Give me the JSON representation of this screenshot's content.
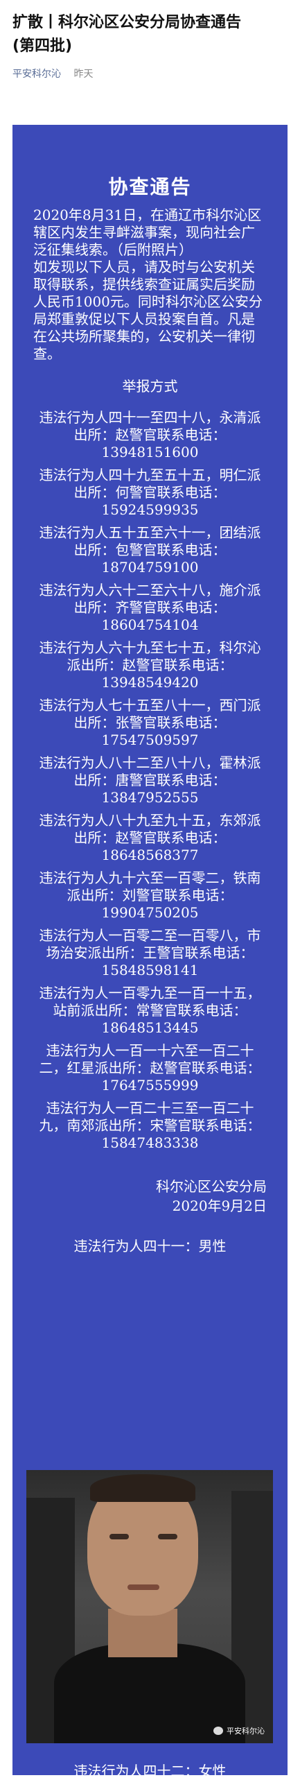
{
  "article": {
    "title_line1": "扩散丨科尔沁区公安分局协查通告",
    "title_line2": "(第四批)",
    "source": "平安科尔沁",
    "time": "昨天"
  },
  "notice": {
    "heading": "协查通告",
    "para1": "2020年8月31日，在通辽市科尔沁区辖区内发生寻衅滋事案，现向社会广泛征集线索。（后附照片）",
    "para2": "如发现以下人员，请及时与公安机关取得联系，提供线索查证属实后奖励人民币1000元。同时科尔沁区公安分局郑重敦促以下人员投案自首。凡是在公共场所聚集的，公安机关一律彻查。",
    "report_head": "举报方式",
    "entries": [
      "违法行为人四十一至四十八，永清派出所：赵警官联系电话：13948151600",
      "违法行为人四十九至五十五，明仁派出所：何警官联系电话：15924599935",
      "违法行为人五十五至六十一，团结派出所：包警官联系电话：18704759100",
      "违法行为人六十二至六十八，施介派出所：齐警官联系电话：18604754104",
      "违法行为人六十九至七十五，科尔沁派出所：赵警官联系电话：13948549420",
      "违法行为人七十五至八十一，西门派出所：张警官联系电话：17547509597",
      "违法行为人八十二至八十八，霍林派出所：唐警官联系电话：13847952555",
      "违法行为人八十九至九十五，东郊派出所：赵警官联系电话：18648568377",
      "违法行为人九十六至一百零二，铁南派出所：刘警官联系电话：19904750205",
      "违法行为人一百零二至一百零八，市场治安派出所：王警官联系电话：15848598141",
      "违法行为人一百零九至一百一十五，站前派出所：常警官联系电话：18648513445",
      "违法行为人一百一十六至一百二十二，红星派出所：赵警官联系电话：17647555999",
      "违法行为人一百二十三至一百二十九，南郊派出所：宋警官联系电话：15847483338"
    ],
    "signature_org": "科尔沁区公安分局",
    "signature_date": "2020年9月2日",
    "suspect_41": "违法行为人四十一：男性",
    "suspect_42": "违法行为人四十二：女性",
    "watermark": "平安科尔沁"
  },
  "colors": {
    "panel_bg": "#3c4ab8",
    "source_link": "#576b95"
  }
}
